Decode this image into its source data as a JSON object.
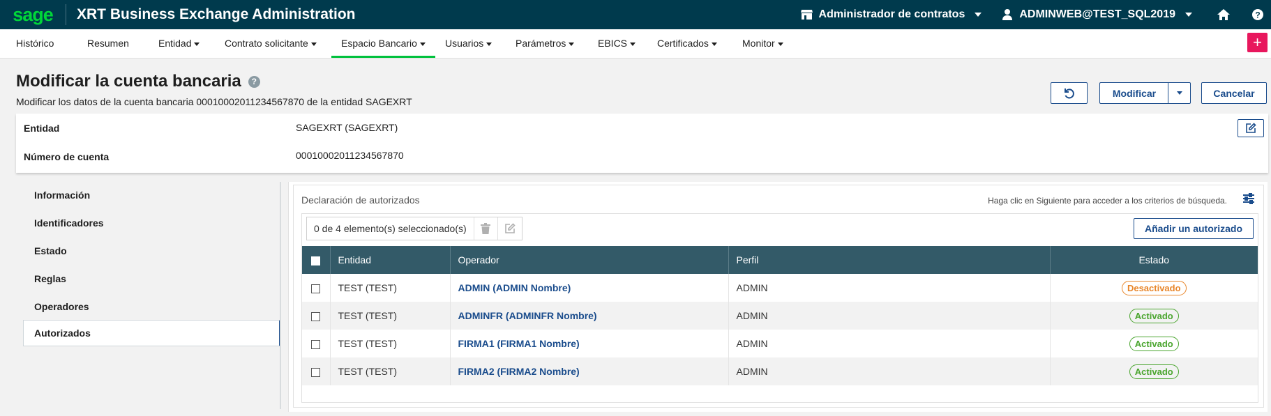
{
  "topbar": {
    "logo": "sage",
    "app_title": "XRT Business Exchange Administration",
    "role": "Administrador de contratos",
    "user": "ADMINWEB@TEST_SQL2019",
    "home_label": "home",
    "help_label": "?"
  },
  "menu": [
    {
      "label": "Histórico",
      "dropdown": false
    },
    {
      "label": "Resumen",
      "dropdown": false
    },
    {
      "label": "Entidad",
      "dropdown": true
    },
    {
      "label": "Contrato solicitante",
      "dropdown": true
    },
    {
      "label": "Espacio Bancario",
      "dropdown": true,
      "active": true
    },
    {
      "label": "Usuarios",
      "dropdown": true
    },
    {
      "label": "Parámetros",
      "dropdown": true
    },
    {
      "label": "EBICS",
      "dropdown": true
    },
    {
      "label": "Certificados",
      "dropdown": true
    },
    {
      "label": "Monitor",
      "dropdown": true
    }
  ],
  "plus_label": "+",
  "header": {
    "title": "Modificar la cuenta bancaria",
    "subtitle": "Modificar los datos de la cuenta bancaria 00010002011234567870 de la entidad SAGEXRT",
    "modify_label": "Modificar",
    "cancel_label": "Cancelar"
  },
  "info": {
    "entity_label": "Entidad",
    "entity_value": "SAGEXRT (SAGEXRT)",
    "account_label": "Número de cuenta",
    "account_value": "00010002011234567870"
  },
  "leftnav": [
    {
      "label": "Información"
    },
    {
      "label": "Identificadores"
    },
    {
      "label": "Estado"
    },
    {
      "label": "Reglas"
    },
    {
      "label": "Operadores"
    },
    {
      "label": "Autorizados",
      "active": true
    }
  ],
  "panel": {
    "title": "Declaración de autorizados",
    "hint": "Haga clic en Siguiente para acceder a los criterios de búsqueda.",
    "selection": "0 de 4 elemento(s) seleccionado(s)",
    "add_label": "Añadir un autorizado",
    "columns": [
      "Entidad",
      "Operador",
      "Perfil",
      "Estado"
    ],
    "rows": [
      {
        "entidad": "TEST (TEST)",
        "operador": "ADMIN (ADMIN Nombre)",
        "perfil": "ADMIN",
        "estado": "Desactivado",
        "status": "off"
      },
      {
        "entidad": "TEST (TEST)",
        "operador": "ADMINFR (ADMINFR Nombre)",
        "perfil": "ADMIN",
        "estado": "Activado",
        "status": "on"
      },
      {
        "entidad": "TEST (TEST)",
        "operador": "FIRMA1 (FIRMA1 Nombre)",
        "perfil": "ADMIN",
        "estado": "Activado",
        "status": "on"
      },
      {
        "entidad": "TEST (TEST)",
        "operador": "FIRMA2 (FIRMA2 Nombre)",
        "perfil": "ADMIN",
        "estado": "Activado",
        "status": "on"
      }
    ]
  },
  "colors": {
    "topbar": "#003a4d",
    "brand_green": "#00d639",
    "primary": "#1a4c8c",
    "table_header": "#335a68",
    "danger_plus": "#e8175d",
    "status_off": "#e8862a",
    "status_on": "#4aa52e"
  }
}
